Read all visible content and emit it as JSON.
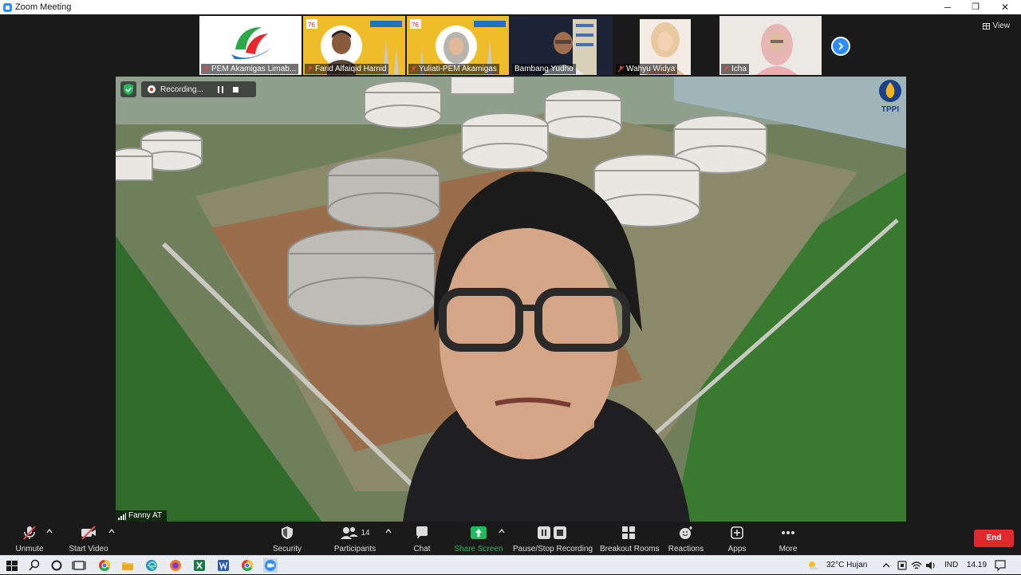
{
  "window": {
    "title": "Zoom Meeting",
    "minimize": "─",
    "restore": "❐",
    "close": "✕"
  },
  "view_label": "View",
  "participants_strip": [
    {
      "name": "PEM Akamigas Limab..."
    },
    {
      "name": "Farid Alfaiqid Hamid"
    },
    {
      "name": "Yuliati-PEM Akamigas"
    },
    {
      "name": "Bambang Yudho"
    },
    {
      "name": "Wahyu Widya"
    },
    {
      "name": "Icha"
    }
  ],
  "recording": {
    "label": "Recording..."
  },
  "logo_text": "TPPI",
  "active_speaker": {
    "name": "Fanny AT"
  },
  "toolbar": {
    "unmute": "Unmute",
    "start_video": "Start Video",
    "security": "Security",
    "participants": "Participants",
    "participants_count": "14",
    "chat": "Chat",
    "share_screen": "Share Screen",
    "pause_stop_recording": "Pause/Stop Recording",
    "breakout_rooms": "Breakout Rooms",
    "reactions": "Reactions",
    "apps": "Apps",
    "more": "More",
    "end": "End"
  },
  "taskbar": {
    "weather": "32°C  Hujan",
    "language": "IND",
    "time": "14.19"
  },
  "colors": {
    "accent": "#2d8cff",
    "end_red": "#e0282d",
    "share_green": "#1fbb5c",
    "mute_red": "#e5484d"
  }
}
